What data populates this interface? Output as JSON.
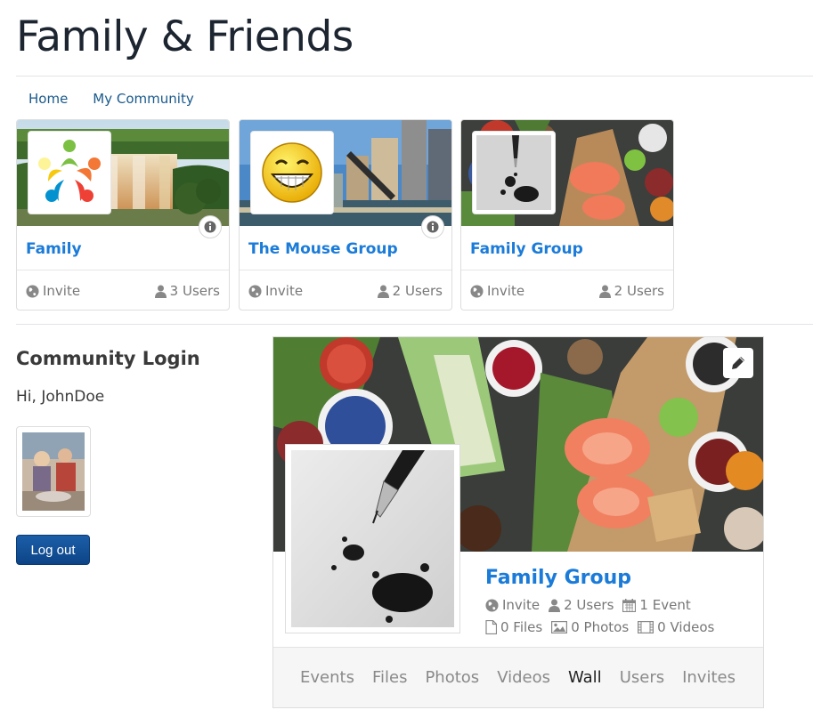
{
  "site": {
    "title": "Family & Friends"
  },
  "nav": {
    "items": [
      {
        "label": "Home"
      },
      {
        "label": "My Community"
      }
    ]
  },
  "groups": [
    {
      "name": "Family",
      "invite": "Invite",
      "users": "3 Users"
    },
    {
      "name": "The Mouse Group",
      "invite": "Invite",
      "users": "2 Users"
    },
    {
      "name": "Family Group",
      "invite": "Invite",
      "users": "2 Users"
    }
  ],
  "login": {
    "title": "Community Login",
    "greeting": "Hi, JohnDoe",
    "logout_label": "Log out"
  },
  "selected_group": {
    "name": "Family Group",
    "invite": "Invite",
    "users": "2 Users",
    "events": "1 Event",
    "files": "0 Files",
    "photos": "0 Photos",
    "videos": "0 Videos",
    "tabs": [
      {
        "label": "Events"
      },
      {
        "label": "Files"
      },
      {
        "label": "Photos"
      },
      {
        "label": "Videos"
      },
      {
        "label": "Wall"
      },
      {
        "label": "Users"
      },
      {
        "label": "Invites"
      }
    ],
    "active_tab": "Wall"
  },
  "colors": {
    "link": "#1a7bd9",
    "nav_link": "#1a5a8c",
    "button": "#0d4486",
    "muted": "#777777"
  },
  "icons": {
    "globe": "globe-icon",
    "user": "user-icon",
    "info": "info-icon",
    "calendar": "calendar-icon",
    "file": "file-icon",
    "photo": "photo-icon",
    "film": "film-icon",
    "pencil": "pencil-icon"
  }
}
